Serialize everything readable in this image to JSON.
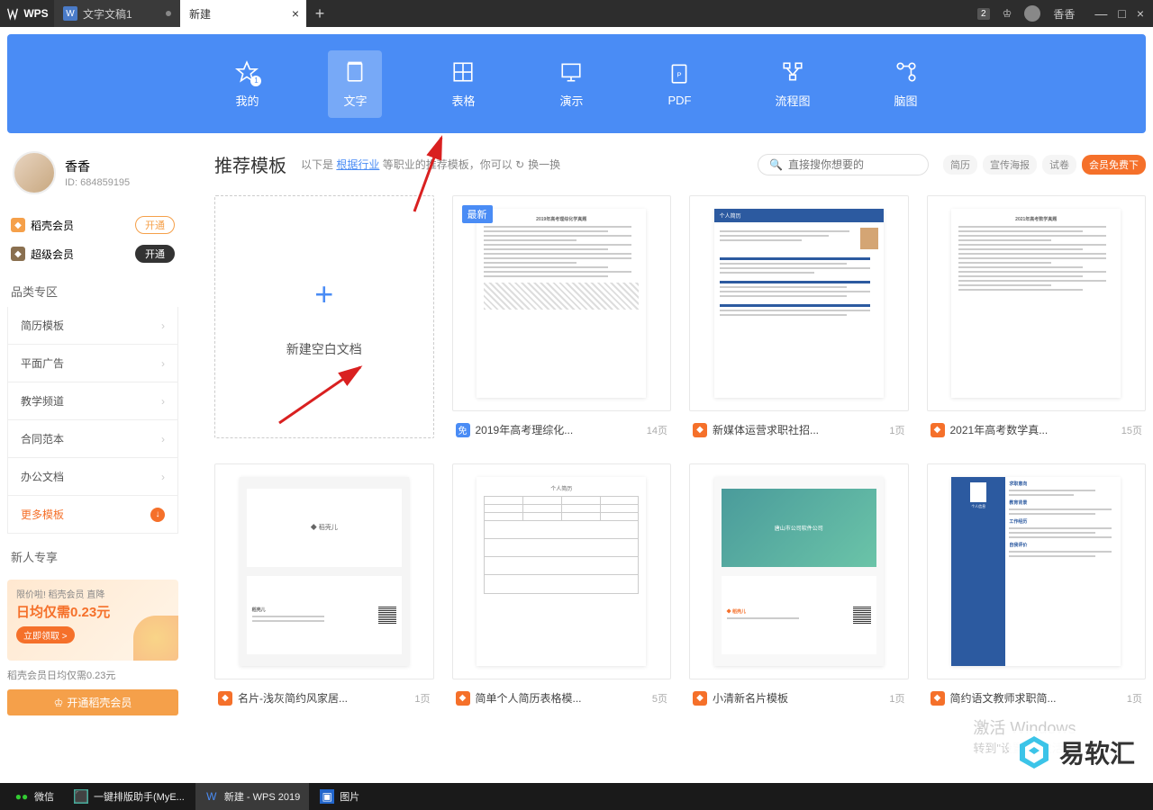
{
  "titlebar": {
    "app": "WPS",
    "tabs": [
      {
        "icon": "W",
        "label": "文字文稿1",
        "active": false
      },
      {
        "icon": "",
        "label": "新建",
        "active": true
      }
    ],
    "badge": "2",
    "username": "香香"
  },
  "navbar": [
    {
      "key": "mine",
      "label": "我的",
      "badge": "1"
    },
    {
      "key": "word",
      "label": "文字",
      "active": true
    },
    {
      "key": "sheet",
      "label": "表格"
    },
    {
      "key": "slide",
      "label": "演示"
    },
    {
      "key": "pdf",
      "label": "PDF"
    },
    {
      "key": "flow",
      "label": "流程图"
    },
    {
      "key": "mind",
      "label": "脑图"
    }
  ],
  "profile": {
    "name": "香香",
    "uid": "ID: 684859195"
  },
  "membership": [
    {
      "icon": "orange",
      "label": "稻壳会员",
      "btn": "开通",
      "btnStyle": "outline"
    },
    {
      "icon": "brown",
      "label": "超级会员",
      "btn": "开通",
      "btnStyle": "fill"
    }
  ],
  "categories": {
    "title": "品类专区",
    "items": [
      "简历模板",
      "平面广告",
      "教学频道",
      "合同范本",
      "办公文档"
    ],
    "more": "更多模板"
  },
  "newbie": {
    "title": "新人专享",
    "line1": "限价啦! 稻壳会员 直降",
    "line2": "日均仅需0.23元",
    "cta": "立即领取 >",
    "note": "稻壳会员日均仅需0.23元",
    "btn": "开通稻壳会员"
  },
  "content": {
    "title": "推荐模板",
    "desc1": "以下是",
    "desc_link": "根据行业",
    "desc2": "等职业的推荐模板，你可以",
    "refresh": "换一换",
    "search_placeholder": "直接搜你想要的",
    "tags": [
      "简历",
      "宣传海报",
      "试卷"
    ],
    "primary_tag": "会员免费下"
  },
  "new_blank": "新建空白文档",
  "new_badge": "最新",
  "templates_row1": [
    {
      "badge": "free",
      "badge_text": "免",
      "name": "2019年高考理综化...",
      "pages": "14页",
      "preview": "doc"
    },
    {
      "badge": "fire",
      "badge_text": "◆",
      "name": "新媒体运营求职社招...",
      "pages": "1页",
      "preview": "resume"
    },
    {
      "badge": "fire",
      "badge_text": "◆",
      "name": "2021年高考数学真...",
      "pages": "15页",
      "preview": "doc"
    }
  ],
  "templates_row2": [
    {
      "badge": "fire",
      "badge_text": "◆",
      "name": "名片-浅灰简约风家居...",
      "pages": "1页",
      "preview": "card"
    },
    {
      "badge": "fire",
      "badge_text": "◆",
      "name": "简单个人简历表格模...",
      "pages": "5页",
      "preview": "table"
    },
    {
      "badge": "fire",
      "badge_text": "◆",
      "name": "小清新名片模板",
      "pages": "1页",
      "preview": "card2"
    },
    {
      "badge": "fire",
      "badge_text": "◆",
      "name": "简约语文教师求职简...",
      "pages": "1页",
      "preview": "resume2"
    }
  ],
  "watermark": {
    "l1": "激活 Windows",
    "l2": "转到\"设置\"以激活 Windows。"
  },
  "brand": "易软汇",
  "taskbar": [
    {
      "icon": "wechat",
      "label": "微信"
    },
    {
      "icon": "app",
      "label": "一键排版助手(MyE..."
    },
    {
      "icon": "wps",
      "label": "新建 - WPS 2019"
    },
    {
      "icon": "img",
      "label": "图片"
    }
  ]
}
